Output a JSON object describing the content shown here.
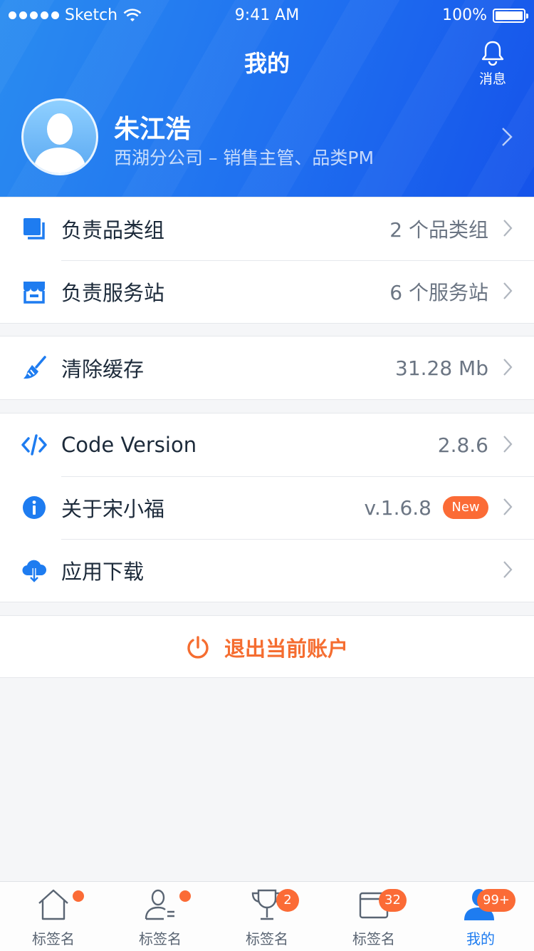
{
  "status_bar": {
    "carrier": "Sketch",
    "time": "9:41 AM",
    "battery": "100%"
  },
  "header": {
    "title": "我的",
    "message_label": "消息",
    "user": {
      "name": "朱江浩",
      "meta": "西湖分公司 – 销售主管、品类PM"
    }
  },
  "groups": {
    "responsibilities": [
      {
        "label": "负责品类组",
        "value": "2 个品类组"
      },
      {
        "label": "负责服务站",
        "value": "6 个服务站"
      }
    ],
    "cache": {
      "label": "清除缓存",
      "value": "31.28 Mb"
    },
    "app": [
      {
        "label": "Code Version",
        "value": "2.8.6"
      },
      {
        "label": "关于宋小福",
        "value": "v.1.6.8",
        "badge": "New"
      },
      {
        "label": "应用下载",
        "value": ""
      }
    ]
  },
  "logout": {
    "label": "退出当前账户"
  },
  "tabbar": [
    {
      "label": "标签名",
      "badge": "dot"
    },
    {
      "label": "标签名",
      "badge": "dot"
    },
    {
      "label": "标签名",
      "badge": "2"
    },
    {
      "label": "标签名",
      "badge": "32"
    },
    {
      "label": "我的",
      "badge": "99+",
      "active": true
    }
  ],
  "colors": {
    "primary": "#1e7cf0",
    "accent": "#fb6b36",
    "danger_text": "#f56d30"
  }
}
